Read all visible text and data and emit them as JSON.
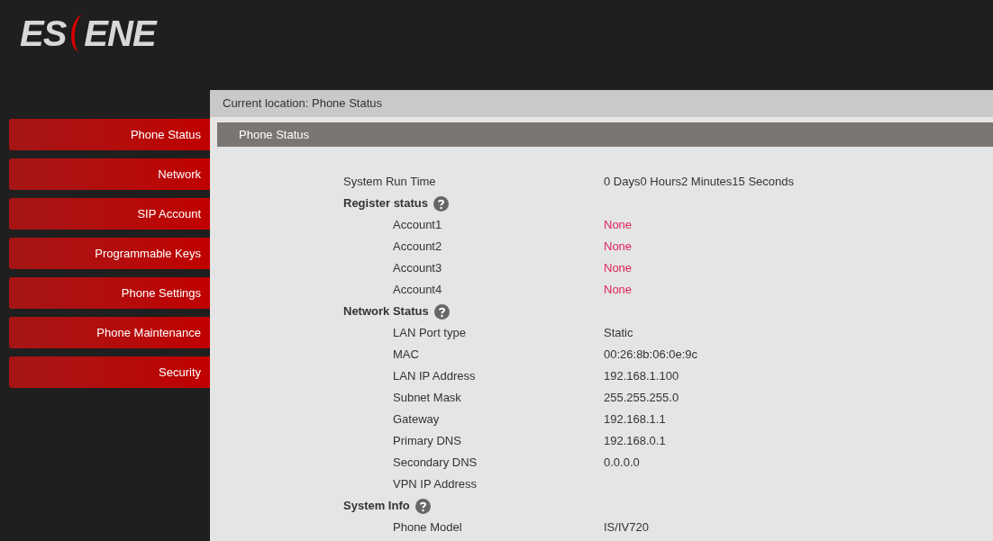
{
  "logo": {
    "before": "ES",
    "after": "ENE"
  },
  "breadcrumb": "Current location: Phone Status",
  "sidebar": {
    "items": [
      {
        "label": "Phone Status"
      },
      {
        "label": "Network"
      },
      {
        "label": "SIP Account"
      },
      {
        "label": "Programmable Keys"
      },
      {
        "label": "Phone Settings"
      },
      {
        "label": "Phone Maintenance"
      },
      {
        "label": "Security"
      }
    ]
  },
  "panel": {
    "title": "Phone Status",
    "items": [
      {
        "kind": "row",
        "label": "System Run Time",
        "value": "0 Days0 Hours2 Minutes15 Seconds"
      },
      {
        "kind": "section",
        "label": "Register status",
        "children": [
          {
            "label": "Account1",
            "value": "None",
            "kind": "alert"
          },
          {
            "label": "Account2",
            "value": "None",
            "kind": "alert"
          },
          {
            "label": "Account3",
            "value": "None",
            "kind": "alert"
          },
          {
            "label": "Account4",
            "value": "None",
            "kind": "alert"
          }
        ]
      },
      {
        "kind": "section",
        "label": "Network Status",
        "children": [
          {
            "label": "LAN Port type",
            "value": "Static",
            "kind": "plain"
          },
          {
            "label": "MAC",
            "value": "00:26:8b:06:0e:9c",
            "kind": "plain"
          },
          {
            "label": "LAN IP Address",
            "value": "192.168.1.100",
            "kind": "plain"
          },
          {
            "label": "Subnet Mask",
            "value": "255.255.255.0",
            "kind": "plain"
          },
          {
            "label": "Gateway",
            "value": "192.168.1.1",
            "kind": "plain"
          },
          {
            "label": "Primary DNS",
            "value": "192.168.0.1",
            "kind": "plain"
          },
          {
            "label": "Secondary DNS",
            "value": "0.0.0.0",
            "kind": "plain"
          },
          {
            "label": "VPN IP Address",
            "kind": "plain"
          }
        ]
      },
      {
        "kind": "section",
        "label": "System Info",
        "children": [
          {
            "label": "Phone Model",
            "value": "IS/IV720",
            "kind": "plain"
          }
        ]
      }
    ]
  }
}
